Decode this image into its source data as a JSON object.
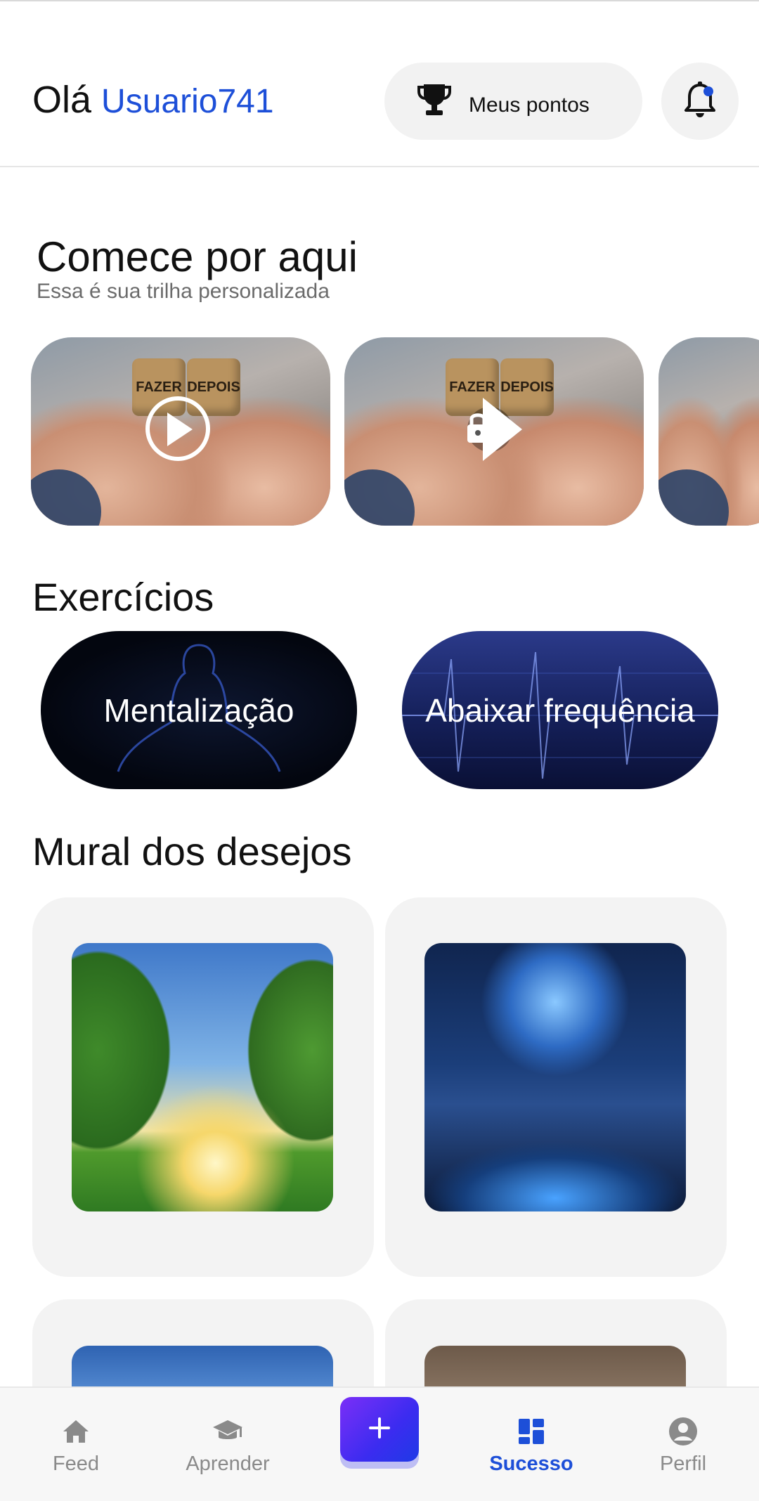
{
  "header": {
    "greeting": "Olá",
    "username": "Usuario741",
    "points_label": "Meus pontos",
    "trophy_icon": "trophy-icon",
    "bell_icon": "bell-icon",
    "accent_color": "#1d4fd8"
  },
  "trail": {
    "title": "Comece por aqui",
    "subtitle": "Essa é sua trilha personalizada",
    "cards": [
      {
        "dice_left": "FAZER",
        "dice_right": "DEPOIS",
        "state": "play"
      },
      {
        "dice_left": "FAZER",
        "dice_right": "DEPOIS",
        "state": "locked"
      },
      {
        "state": "partial"
      }
    ]
  },
  "exercises": {
    "title": "Exercícios",
    "items": [
      {
        "label": "Mentalização"
      },
      {
        "label": "Abaixar frequência"
      }
    ]
  },
  "mural": {
    "title": "Mural dos desejos"
  },
  "nav": {
    "items": [
      {
        "label": "Feed",
        "icon": "home-icon"
      },
      {
        "label": "Aprender",
        "icon": "graduation-cap-icon"
      },
      {
        "label": "Sucesso",
        "icon": "dashboard-icon",
        "active": true
      },
      {
        "label": "Perfil",
        "icon": "profile-icon"
      }
    ],
    "fab_icon": "plus-icon"
  }
}
